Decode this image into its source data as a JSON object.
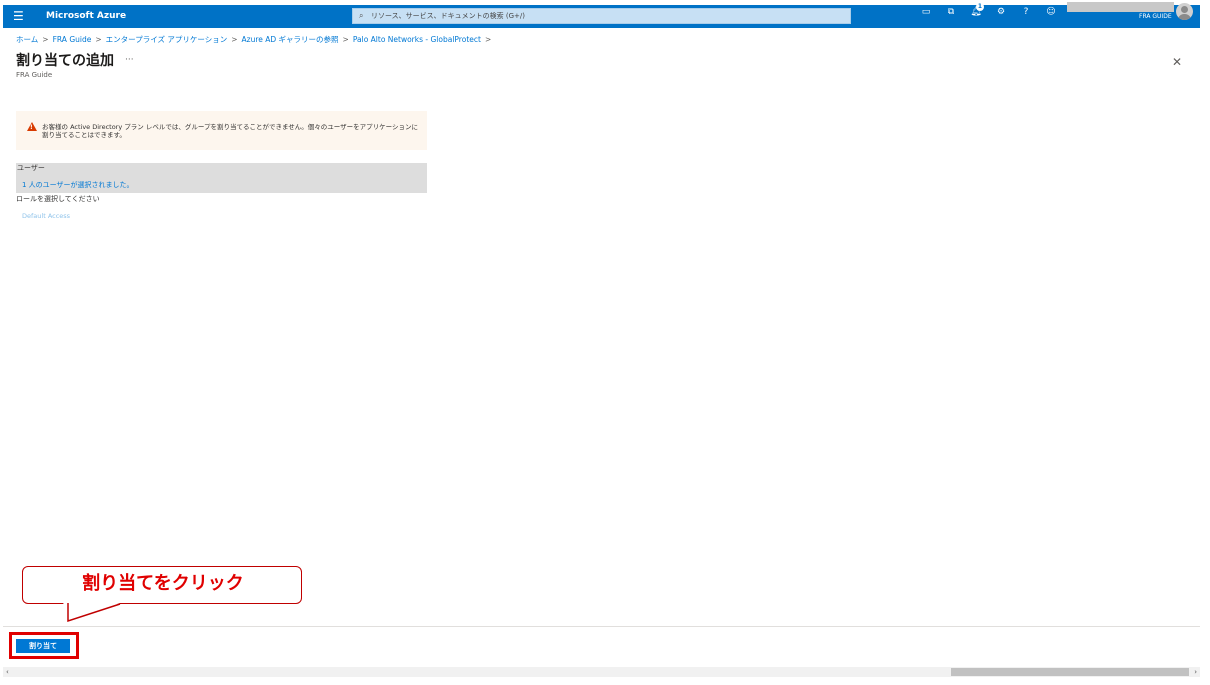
{
  "topbar": {
    "menu_icon": "hamburger-icon",
    "brand": "Microsoft Azure",
    "search_placeholder": "リソース、サービス、ドキュメントの検索 (G+/)",
    "icons": [
      "cloud-shell-icon",
      "directory-filter-icon",
      "notifications-icon",
      "settings-icon",
      "help-icon",
      "feedback-icon"
    ],
    "notification_count": "1",
    "account_name": "FRA GUIDE"
  },
  "breadcrumb": [
    "ホーム",
    "FRA Guide",
    "エンタープライズ アプリケーション",
    "Azure AD ギャラリーの参照",
    "Palo Alto Networks - GlobalProtect"
  ],
  "page": {
    "title": "割り当ての追加",
    "more": "···",
    "subtitle": "FRA Guide",
    "close": "✕"
  },
  "warning": {
    "icon": "warning-icon",
    "text": "お客様の Active Directory プラン レベルでは、グループを割り当てることができません。個々のユーザーをアプリケーションに割り当てることはできます。"
  },
  "users": {
    "label": "ユーザー",
    "selected": "1 人のユーザーが選択されました。"
  },
  "role": {
    "label": "ロールを選択してください",
    "value": "Default Access"
  },
  "callout": {
    "text": "割り当てをクリック"
  },
  "footer": {
    "assign_label": "割り当て"
  },
  "colors": {
    "azure_blue": "#0072c6",
    "accent": "#0078d4",
    "highlight_red": "#e00000"
  }
}
